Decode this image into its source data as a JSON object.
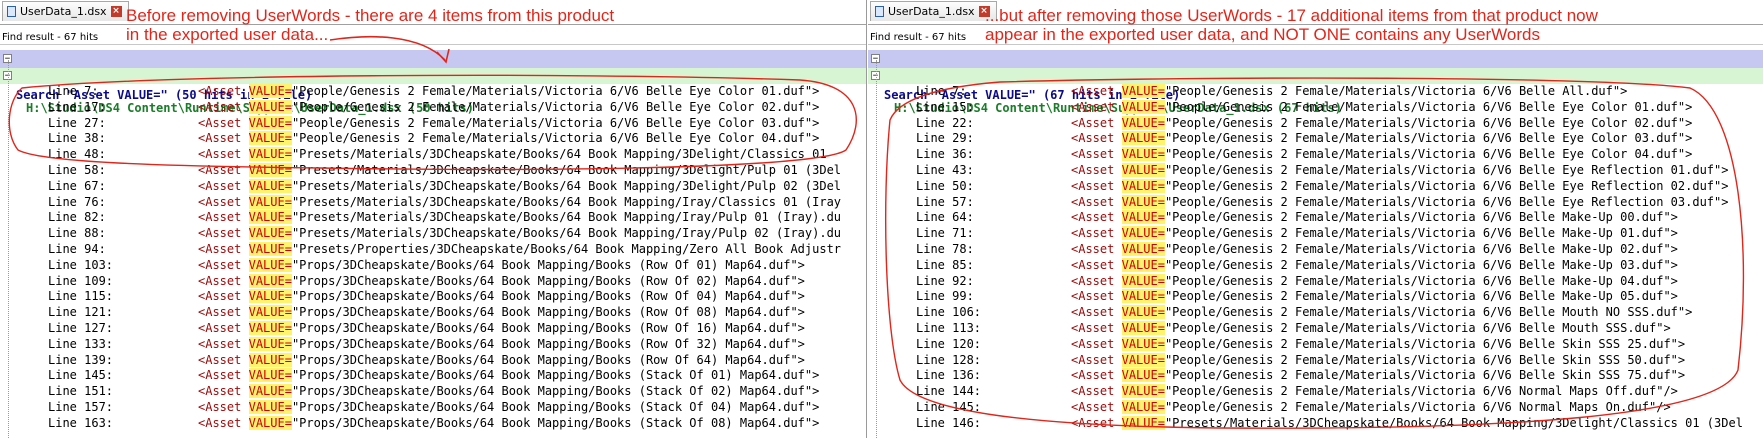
{
  "left": {
    "tab_label": "UserData_1.dsx",
    "find_title": "Find result - 67 hits",
    "search_header": "Search \"Asset VALUE=\" (50 hits in 1 file)",
    "file_header": "H:\\Studio\\DS4 Content\\Runtime\\Support\\UserData_1.dsx (50 hits)",
    "annotation_line1": "Before removing UserWords - there are 4 items from this product",
    "annotation_line2": "in the exported user data...",
    "lines": [
      {
        "num": "Line 7:",
        "value": "\"People/Genesis 2 Female/Materials/Victoria 6/V6 Belle Eye Color 01.duf\">"
      },
      {
        "num": "Line 17:",
        "value": "\"People/Genesis 2 Female/Materials/Victoria 6/V6 Belle Eye Color 02.duf\">"
      },
      {
        "num": "Line 27:",
        "value": "\"People/Genesis 2 Female/Materials/Victoria 6/V6 Belle Eye Color 03.duf\">"
      },
      {
        "num": "Line 38:",
        "value": "\"People/Genesis 2 Female/Materials/Victoria 6/V6 Belle Eye Color 04.duf\">"
      },
      {
        "num": "Line 48:",
        "value": "\"Presets/Materials/3DCheapskate/Books/64 Book Mapping/3Delight/Classics 01"
      },
      {
        "num": "Line 58:",
        "value": "\"Presets/Materials/3DCheapskate/Books/64 Book Mapping/3Delight/Pulp 01 (3Del"
      },
      {
        "num": "Line 67:",
        "value": "\"Presets/Materials/3DCheapskate/Books/64 Book Mapping/3Delight/Pulp 02 (3Del"
      },
      {
        "num": "Line 76:",
        "value": "\"Presets/Materials/3DCheapskate/Books/64 Book Mapping/Iray/Classics 01 (Iray"
      },
      {
        "num": "Line 82:",
        "value": "\"Presets/Materials/3DCheapskate/Books/64 Book Mapping/Iray/Pulp 01 (Iray).du"
      },
      {
        "num": "Line 88:",
        "value": "\"Presets/Materials/3DCheapskate/Books/64 Book Mapping/Iray/Pulp 02 (Iray).du"
      },
      {
        "num": "Line 94:",
        "value": "\"Presets/Properties/3DCheapskate/Books/64 Book Mapping/Zero All Book Adjustr"
      },
      {
        "num": "Line 103:",
        "value": "\"Props/3DCheapskate/Books/64 Book Mapping/Books (Row Of 01) Map64.duf\">"
      },
      {
        "num": "Line 109:",
        "value": "\"Props/3DCheapskate/Books/64 Book Mapping/Books (Row Of 02) Map64.duf\">"
      },
      {
        "num": "Line 115:",
        "value": "\"Props/3DCheapskate/Books/64 Book Mapping/Books (Row Of 04) Map64.duf\">"
      },
      {
        "num": "Line 121:",
        "value": "\"Props/3DCheapskate/Books/64 Book Mapping/Books (Row Of 08) Map64.duf\">"
      },
      {
        "num": "Line 127:",
        "value": "\"Props/3DCheapskate/Books/64 Book Mapping/Books (Row Of 16) Map64.duf\">"
      },
      {
        "num": "Line 133:",
        "value": "\"Props/3DCheapskate/Books/64 Book Mapping/Books (Row Of 32) Map64.duf\">"
      },
      {
        "num": "Line 139:",
        "value": "\"Props/3DCheapskate/Books/64 Book Mapping/Books (Row Of 64) Map64.duf\">"
      },
      {
        "num": "Line 145:",
        "value": "\"Props/3DCheapskate/Books/64 Book Mapping/Books (Stack Of 01) Map64.duf\">"
      },
      {
        "num": "Line 151:",
        "value": "\"Props/3DCheapskate/Books/64 Book Mapping/Books (Stack Of 02) Map64.duf\">"
      },
      {
        "num": "Line 157:",
        "value": "\"Props/3DCheapskate/Books/64 Book Mapping/Books (Stack Of 04) Map64.duf\">"
      },
      {
        "num": "Line 163:",
        "value": "\"Props/3DCheapskate/Books/64 Book Mapping/Books (Stack Of 08) Map64.duf\">"
      }
    ]
  },
  "right": {
    "tab_label": "UserData_1.dsx",
    "find_title": "Find result - 67 hits",
    "search_header": "Search \"Asset VALUE=\" (67 hits in 1 file)",
    "file_header": "H:\\Studio\\DS4 Content\\Runtime\\Support\\UserData_1.dsx (67 hits)",
    "annotation_line1": "...but after removing those UserWords - 17 additional items from that product now",
    "annotation_line2": "appear in the exported user data, and NOT ONE contains any UserWords",
    "lines": [
      {
        "num": "Line 7:",
        "value": "\"People/Genesis 2 Female/Materials/Victoria 6/V6 Belle All.duf\">"
      },
      {
        "num": "Line 15:",
        "value": "\"People/Genesis 2 Female/Materials/Victoria 6/V6 Belle Eye Color 01.duf\">"
      },
      {
        "num": "Line 22:",
        "value": "\"People/Genesis 2 Female/Materials/Victoria 6/V6 Belle Eye Color 02.duf\">"
      },
      {
        "num": "Line 29:",
        "value": "\"People/Genesis 2 Female/Materials/Victoria 6/V6 Belle Eye Color 03.duf\">"
      },
      {
        "num": "Line 36:",
        "value": "\"People/Genesis 2 Female/Materials/Victoria 6/V6 Belle Eye Color 04.duf\">"
      },
      {
        "num": "Line 43:",
        "value": "\"People/Genesis 2 Female/Materials/Victoria 6/V6 Belle Eye Reflection 01.duf\">"
      },
      {
        "num": "Line 50:",
        "value": "\"People/Genesis 2 Female/Materials/Victoria 6/V6 Belle Eye Reflection 02.duf\">"
      },
      {
        "num": "Line 57:",
        "value": "\"People/Genesis 2 Female/Materials/Victoria 6/V6 Belle Eye Reflection 03.duf\">"
      },
      {
        "num": "Line 64:",
        "value": "\"People/Genesis 2 Female/Materials/Victoria 6/V6 Belle Make-Up 00.duf\">"
      },
      {
        "num": "Line 71:",
        "value": "\"People/Genesis 2 Female/Materials/Victoria 6/V6 Belle Make-Up 01.duf\">"
      },
      {
        "num": "Line 78:",
        "value": "\"People/Genesis 2 Female/Materials/Victoria 6/V6 Belle Make-Up 02.duf\">"
      },
      {
        "num": "Line 85:",
        "value": "\"People/Genesis 2 Female/Materials/Victoria 6/V6 Belle Make-Up 03.duf\">"
      },
      {
        "num": "Line 92:",
        "value": "\"People/Genesis 2 Female/Materials/Victoria 6/V6 Belle Make-Up 04.duf\">"
      },
      {
        "num": "Line 99:",
        "value": "\"People/Genesis 2 Female/Materials/Victoria 6/V6 Belle Make-Up 05.duf\">"
      },
      {
        "num": "Line 106:",
        "value": "\"People/Genesis 2 Female/Materials/Victoria 6/V6 Belle Mouth NO SSS.duf\">"
      },
      {
        "num": "Line 113:",
        "value": "\"People/Genesis 2 Female/Materials/Victoria 6/V6 Belle Mouth SSS.duf\">"
      },
      {
        "num": "Line 120:",
        "value": "\"People/Genesis 2 Female/Materials/Victoria 6/V6 Belle Skin SSS 25.duf\">"
      },
      {
        "num": "Line 128:",
        "value": "\"People/Genesis 2 Female/Materials/Victoria 6/V6 Belle Skin SSS 50.duf\">"
      },
      {
        "num": "Line 136:",
        "value": "\"People/Genesis 2 Female/Materials/Victoria 6/V6 Belle Skin SSS 75.duf\">"
      },
      {
        "num": "Line 144:",
        "value": "\"People/Genesis 2 Female/Materials/Victoria 6/V6 Normal Maps Off.duf\"/>"
      },
      {
        "num": "Line 145:",
        "value": "\"People/Genesis 2 Female/Materials/Victoria 6/V6 Normal Maps On.duf\"/>"
      },
      {
        "num": "Line 146:",
        "value": "\"Presets/Materials/3DCheapskate/Books/64 Book Mapping/3Delight/Classics 01 (3Del"
      }
    ]
  },
  "syntax": {
    "tag": "<Asset",
    "attr": "VALUE="
  },
  "fold_collapse_glyph": "−",
  "close_glyph": "×"
}
